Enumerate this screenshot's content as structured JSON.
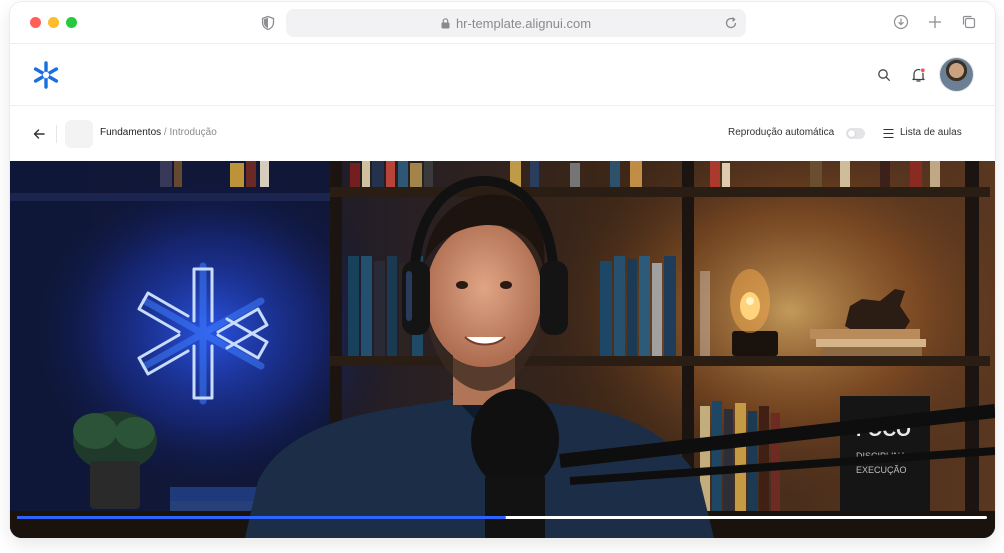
{
  "browser": {
    "url": "hr-template.alignui.com"
  },
  "breadcrumb": {
    "parent": "Fundamentos",
    "separator": " / ",
    "current": "Introdução"
  },
  "controls": {
    "autoplay_label": "Reprodução automática",
    "autoplay_on": false,
    "lesson_list_label": "Lista de aulas"
  },
  "video": {
    "progress_percent": 50.4,
    "book_title": "FOCO",
    "book_subtitle_1": "DISCIPLINA",
    "book_subtitle_2": "EXECUÇÃO"
  },
  "colors": {
    "brand": "#1a6fe0",
    "progress": "#2f63ff",
    "neon": "#3d7dff"
  },
  "icons": [
    "shield-icon",
    "lock-icon",
    "reload-icon",
    "download-icon",
    "plus-icon",
    "tabs-icon",
    "search-icon",
    "bell-icon",
    "back-arrow-icon",
    "list-icon"
  ]
}
